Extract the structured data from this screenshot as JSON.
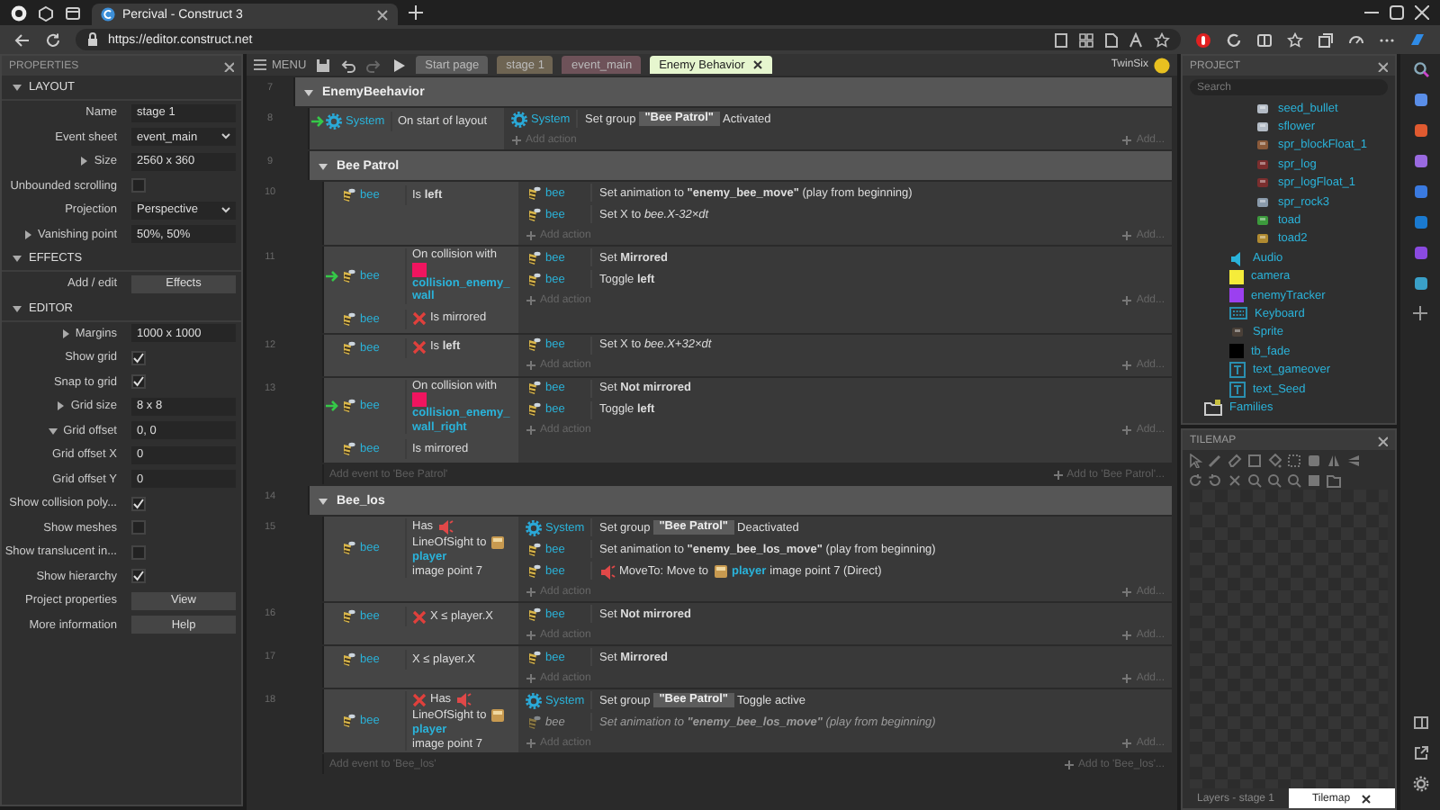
{
  "browser": {
    "tabs": [
      {
        "title": "Percival - Construct 3",
        "selected": true
      }
    ],
    "url": "https://editor.construct.net"
  },
  "properties": {
    "title": "PROPERTIES",
    "sections": [
      {
        "title": "LAYOUT",
        "expanded": true,
        "rows": [
          {
            "kind": "text",
            "label": "Name",
            "value": "stage 1"
          },
          {
            "kind": "select",
            "label": "Event sheet",
            "value": "event_main"
          },
          {
            "kind": "text",
            "label": "Size",
            "value": "2560 x 360",
            "expanded": false
          },
          {
            "kind": "checkbox",
            "label": "Unbounded scrolling",
            "checked": false
          },
          {
            "kind": "select",
            "label": "Projection",
            "value": "Perspective"
          },
          {
            "kind": "text",
            "label": "Vanishing point",
            "value": "50%, 50%",
            "expanded": false
          }
        ]
      },
      {
        "title": "EFFECTS",
        "expanded": true,
        "rows": [
          {
            "kind": "button",
            "label": "Add / edit",
            "value": "Effects"
          }
        ]
      },
      {
        "title": "EDITOR",
        "expanded": true,
        "rows": [
          {
            "kind": "text",
            "label": "Margins",
            "value": "1000 x 1000",
            "expanded": false
          },
          {
            "kind": "checkbox",
            "label": "Show grid",
            "checked": true
          },
          {
            "kind": "checkbox",
            "label": "Snap to grid",
            "checked": true
          },
          {
            "kind": "text",
            "label": "Grid size",
            "value": "8 x 8",
            "expanded": false
          },
          {
            "kind": "text",
            "label": "Grid offset",
            "value": "0, 0",
            "expanded": true
          },
          {
            "kind": "text",
            "label": "Grid offset X",
            "value": "0"
          },
          {
            "kind": "text",
            "label": "Grid offset Y",
            "value": "0"
          },
          {
            "kind": "checkbox",
            "label": "Show collision poly...",
            "checked": true
          },
          {
            "kind": "checkbox",
            "label": "Show meshes",
            "checked": false
          },
          {
            "kind": "checkbox",
            "label": "Show translucent in...",
            "checked": false
          },
          {
            "kind": "checkbox",
            "label": "Show hierarchy",
            "checked": true
          },
          {
            "kind": "button",
            "label": "Project properties",
            "value": "View"
          },
          {
            "kind": "button",
            "label": "More information",
            "value": "Help"
          }
        ]
      }
    ]
  },
  "editor_toolbar": {
    "menu": "MENU",
    "tabs": [
      {
        "label": "Start page",
        "color": "#5b5b5b",
        "selected": false
      },
      {
        "label": "stage 1",
        "color": "#6e6452",
        "selected": false
      },
      {
        "label": "event_main",
        "color": "#6e5259",
        "selected": false
      },
      {
        "label": "Enemy Behavior",
        "color": "#e6f6cf",
        "selected": true
      }
    ],
    "user": "TwinSix"
  },
  "event_sheet": {
    "items": [
      {
        "kind": "group",
        "number": "7",
        "title": "EnemyBeehavior",
        "expanded": true,
        "children": [
          {
            "kind": "event",
            "number": "8",
            "conditions": [
              {
                "object": {
                  "label": "System",
                  "kind": "system"
                },
                "trigger": true,
                "inverted": false,
                "parts": [
                  {
                    "kind": "text",
                    "text": "On start of layout"
                  }
                ]
              }
            ],
            "actions": [
              {
                "object": {
                  "label": "System",
                  "kind": "system"
                },
                "disabled": false,
                "parts": [
                  {
                    "kind": "text",
                    "text": "Set group"
                  },
                  {
                    "kind": "chip",
                    "text": "\"Bee Patrol\""
                  },
                  {
                    "kind": "text",
                    "text": "Activated"
                  }
                ]
              }
            ],
            "add_action": "Add action",
            "add_more": "Add..."
          },
          {
            "kind": "group",
            "number": "9",
            "title": "Bee Patrol",
            "expanded": true,
            "add_event": "Add event to 'Bee Patrol'",
            "add_to": "Add to 'Bee Patrol'...",
            "children": [
              {
                "kind": "event",
                "number": "10",
                "conditions": [
                  {
                    "object": {
                      "label": "bee",
                      "kind": "sprite"
                    },
                    "trigger": false,
                    "inverted": false,
                    "parts": [
                      {
                        "kind": "text",
                        "text": "Is **left**"
                      }
                    ]
                  }
                ],
                "actions": [
                  {
                    "object": {
                      "label": "bee",
                      "kind": "sprite"
                    },
                    "disabled": false,
                    "parts": [
                      {
                        "kind": "text",
                        "text": "Set animation to **\"enemy_bee_move\"** (play from beginning)"
                      }
                    ]
                  },
                  {
                    "object": {
                      "label": "bee",
                      "kind": "sprite"
                    },
                    "disabled": false,
                    "parts": [
                      {
                        "kind": "text",
                        "text": "Set X to *bee.X-32×dt*"
                      }
                    ]
                  }
                ],
                "add_action": "Add action",
                "add_more": "Add..."
              },
              {
                "kind": "event",
                "number": "11",
                "conditions": [
                  {
                    "object": {
                      "label": "bee",
                      "kind": "sprite"
                    },
                    "trigger": true,
                    "inverted": false,
                    "parts": [
                      {
                        "kind": "text",
                        "text": "On collision with"
                      },
                      {
                        "kind": "swatch",
                        "color": "#f0145f"
                      },
                      {
                        "kind": "object",
                        "text": "collision_enemy_wall"
                      }
                    ]
                  },
                  {
                    "object": {
                      "label": "bee",
                      "kind": "sprite"
                    },
                    "trigger": false,
                    "inverted": true,
                    "parts": [
                      {
                        "kind": "text",
                        "text": "Is mirrored"
                      }
                    ]
                  }
                ],
                "actions": [
                  {
                    "object": {
                      "label": "bee",
                      "kind": "sprite"
                    },
                    "disabled": false,
                    "parts": [
                      {
                        "kind": "text",
                        "text": "Set **Mirrored**"
                      }
                    ]
                  },
                  {
                    "object": {
                      "label": "bee",
                      "kind": "sprite"
                    },
                    "disabled": false,
                    "parts": [
                      {
                        "kind": "text",
                        "text": "Toggle **left**"
                      }
                    ]
                  }
                ],
                "add_action": "Add action",
                "add_more": "Add..."
              },
              {
                "kind": "event",
                "number": "12",
                "conditions": [
                  {
                    "object": {
                      "label": "bee",
                      "kind": "sprite"
                    },
                    "trigger": false,
                    "inverted": true,
                    "parts": [
                      {
                        "kind": "text",
                        "text": "Is **left**"
                      }
                    ]
                  }
                ],
                "actions": [
                  {
                    "object": {
                      "label": "bee",
                      "kind": "sprite"
                    },
                    "disabled": false,
                    "parts": [
                      {
                        "kind": "text",
                        "text": "Set X to *bee.X+32×dt*"
                      }
                    ]
                  }
                ],
                "add_action": "Add action",
                "add_more": "Add..."
              },
              {
                "kind": "event",
                "number": "13",
                "conditions": [
                  {
                    "object": {
                      "label": "bee",
                      "kind": "sprite"
                    },
                    "trigger": true,
                    "inverted": false,
                    "parts": [
                      {
                        "kind": "text",
                        "text": "On collision with"
                      },
                      {
                        "kind": "swatch",
                        "color": "#f0145f"
                      },
                      {
                        "kind": "object",
                        "text": "collision_enemy_wall_right"
                      }
                    ]
                  },
                  {
                    "object": {
                      "label": "bee",
                      "kind": "sprite"
                    },
                    "trigger": false,
                    "inverted": false,
                    "parts": [
                      {
                        "kind": "text",
                        "text": "Is mirrored"
                      }
                    ]
                  }
                ],
                "actions": [
                  {
                    "object": {
                      "label": "bee",
                      "kind": "sprite"
                    },
                    "disabled": false,
                    "parts": [
                      {
                        "kind": "text",
                        "text": "Set **Not mirrored**"
                      }
                    ]
                  },
                  {
                    "object": {
                      "label": "bee",
                      "kind": "sprite"
                    },
                    "disabled": false,
                    "parts": [
                      {
                        "kind": "text",
                        "text": "Toggle **left**"
                      }
                    ]
                  }
                ],
                "add_action": "Add action",
                "add_more": "Add..."
              }
            ]
          },
          {
            "kind": "group",
            "number": "14",
            "title": "Bee_los",
            "expanded": true,
            "add_event": "Add event to 'Bee_los'",
            "add_to": "Add to 'Bee_los'...",
            "children": [
              {
                "kind": "event",
                "number": "15",
                "conditions": [
                  {
                    "object": {
                      "label": "bee",
                      "kind": "sprite"
                    },
                    "trigger": false,
                    "inverted": false,
                    "parts": [
                      {
                        "kind": "text",
                        "text": "Has"
                      },
                      {
                        "kind": "behavior"
                      },
                      {
                        "kind": "text",
                        "text": "LineOfSight to"
                      },
                      {
                        "kind": "sprite"
                      },
                      {
                        "kind": "object",
                        "text": "player"
                      },
                      {
                        "kind": "text",
                        "text": "image point 7"
                      }
                    ]
                  }
                ],
                "actions": [
                  {
                    "object": {
                      "label": "System",
                      "kind": "system"
                    },
                    "disabled": false,
                    "parts": [
                      {
                        "kind": "text",
                        "text": "Set group"
                      },
                      {
                        "kind": "chip",
                        "text": "\"Bee Patrol\""
                      },
                      {
                        "kind": "text",
                        "text": "Deactivated"
                      }
                    ]
                  },
                  {
                    "object": {
                      "label": "bee",
                      "kind": "sprite"
                    },
                    "disabled": false,
                    "parts": [
                      {
                        "kind": "text",
                        "text": "Set animation to **\"enemy_bee_los_move\"** (play from beginning)"
                      }
                    ]
                  },
                  {
                    "object": {
                      "label": "bee",
                      "kind": "sprite"
                    },
                    "disabled": false,
                    "parts": [
                      {
                        "kind": "behavior"
                      },
                      {
                        "kind": "text",
                        "text": "MoveTo: Move to"
                      },
                      {
                        "kind": "sprite"
                      },
                      {
                        "kind": "object",
                        "text": "player"
                      },
                      {
                        "kind": "text",
                        "text": "image point 7 (Direct)"
                      }
                    ]
                  }
                ],
                "add_action": "Add action",
                "add_more": "Add..."
              },
              {
                "kind": "event",
                "number": "16",
                "conditions": [
                  {
                    "object": {
                      "label": "bee",
                      "kind": "sprite"
                    },
                    "trigger": false,
                    "inverted": true,
                    "parts": [
                      {
                        "kind": "text",
                        "text": "X ≤ player.X"
                      }
                    ]
                  }
                ],
                "actions": [
                  {
                    "object": {
                      "label": "bee",
                      "kind": "sprite"
                    },
                    "disabled": false,
                    "parts": [
                      {
                        "kind": "text",
                        "text": "Set **Not mirrored**"
                      }
                    ]
                  }
                ],
                "add_action": "Add action",
                "add_more": "Add..."
              },
              {
                "kind": "event",
                "number": "17",
                "conditions": [
                  {
                    "object": {
                      "label": "bee",
                      "kind": "sprite"
                    },
                    "trigger": false,
                    "inverted": false,
                    "parts": [
                      {
                        "kind": "text",
                        "text": "X ≤ player.X"
                      }
                    ]
                  }
                ],
                "actions": [
                  {
                    "object": {
                      "label": "bee",
                      "kind": "sprite"
                    },
                    "disabled": false,
                    "parts": [
                      {
                        "kind": "text",
                        "text": "Set **Mirrored**"
                      }
                    ]
                  }
                ],
                "add_action": "Add action",
                "add_more": "Add..."
              },
              {
                "kind": "event",
                "number": "18",
                "conditions": [
                  {
                    "object": {
                      "label": "bee",
                      "kind": "sprite"
                    },
                    "trigger": false,
                    "inverted": true,
                    "parts": [
                      {
                        "kind": "text",
                        "text": "Has"
                      },
                      {
                        "kind": "behavior"
                      },
                      {
                        "kind": "text",
                        "text": "LineOfSight to"
                      },
                      {
                        "kind": "sprite"
                      },
                      {
                        "kind": "object",
                        "text": "player"
                      },
                      {
                        "kind": "text",
                        "text": "image point 7"
                      }
                    ]
                  }
                ],
                "actions": [
                  {
                    "object": {
                      "label": "System",
                      "kind": "system"
                    },
                    "disabled": false,
                    "parts": [
                      {
                        "kind": "text",
                        "text": "Set group"
                      },
                      {
                        "kind": "chip",
                        "text": "\"Bee Patrol\""
                      },
                      {
                        "kind": "text",
                        "text": "Toggle active"
                      }
                    ]
                  },
                  {
                    "object": {
                      "label": "bee",
                      "kind": "sprite"
                    },
                    "disabled": true,
                    "parts": [
                      {
                        "kind": "text",
                        "text": "Set animation to **\"enemy_bee_los_move\"** (play from beginning)"
                      }
                    ]
                  }
                ],
                "add_action": "Add action",
                "add_more": "Add..."
              }
            ]
          }
        ]
      }
    ]
  },
  "project": {
    "title": "PROJECT",
    "search": {
      "placeholder": "Search"
    },
    "tree": [
      {
        "children": [
          {
            "children": [
              {
                "label": "seed_bullet",
                "kind": "sprite",
                "color": "#b4bcc6"
              },
              {
                "label": "sflower",
                "kind": "sprite",
                "color": "#b4bcc6"
              },
              {
                "label": "spr_blockFloat_1",
                "kind": "sprite",
                "color": "#8a5a3a"
              },
              {
                "label": "spr_log",
                "kind": "sprite",
                "color": "#7a2e2e"
              },
              {
                "label": "spr_logFloat_1",
                "kind": "sprite",
                "color": "#7a2e2e"
              },
              {
                "label": "spr_rock3",
                "kind": "sprite",
                "color": "#8a9aaa"
              },
              {
                "label": "toad",
                "kind": "sprite",
                "color": "#3c9a3c"
              },
              {
                "label": "toad2",
                "kind": "sprite",
                "color": "#b08a30"
              }
            ]
          },
          {
            "label": "Audio",
            "kind": "audio"
          },
          {
            "label": "camera",
            "kind": "swatch",
            "color": "#f5ec3a"
          },
          {
            "label": "enemyTracker",
            "kind": "swatch",
            "color": "#9b40f0"
          },
          {
            "label": "Keyboard",
            "kind": "keyboard"
          },
          {
            "label": "Sprite",
            "kind": "sprite",
            "color": "#4a4038"
          },
          {
            "label": "tb_fade",
            "kind": "swatch",
            "color": "#000000"
          },
          {
            "label": "text_gameover",
            "kind": "text"
          },
          {
            "label": "text_Seed",
            "kind": "text"
          }
        ]
      },
      {
        "label": "Families",
        "kind": "folder"
      }
    ]
  },
  "tilemap": {
    "title": "TILEMAP",
    "tabs": [
      {
        "label": "Layers - stage 1",
        "selected": false
      },
      {
        "label": "Tilemap",
        "selected": true
      }
    ]
  }
}
